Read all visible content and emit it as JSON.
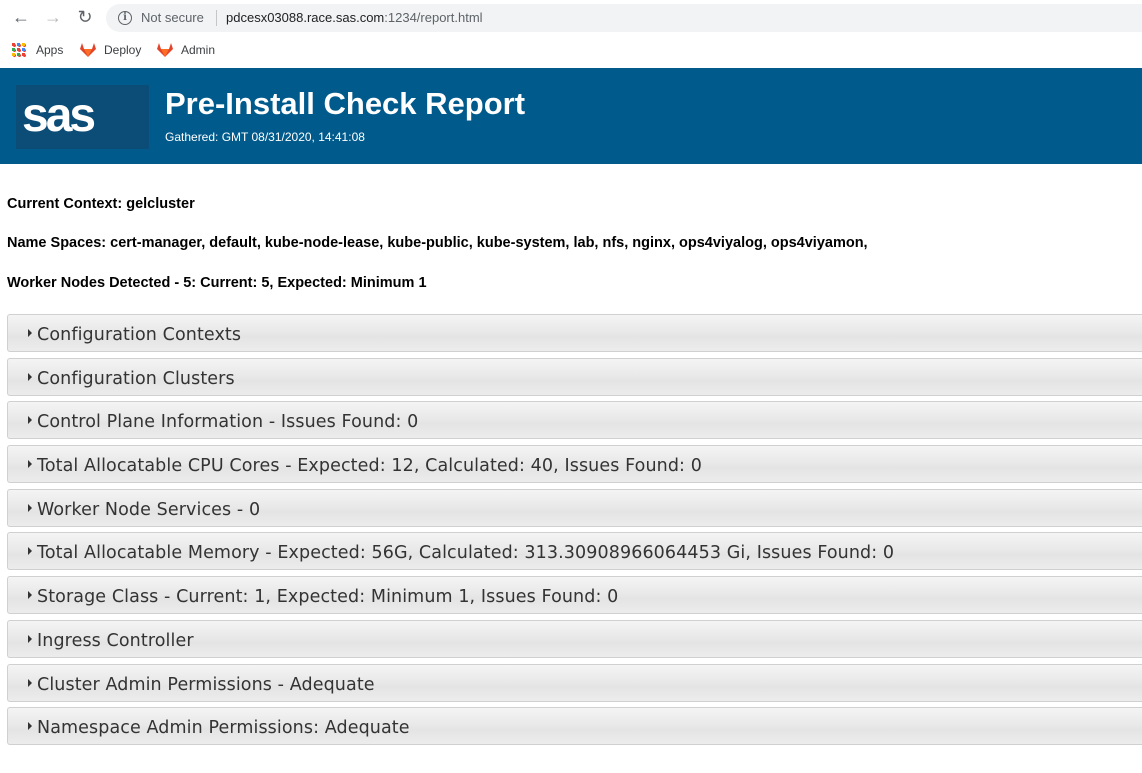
{
  "browser": {
    "security_label": "Not secure",
    "url_host": "pdcesx03088.race.sas.com",
    "url_rest": ":1234/report.html",
    "bookmarks": [
      {
        "label": "Apps",
        "icon": "apps-grid-icon"
      },
      {
        "label": "Deploy",
        "icon": "gitlab-fox-icon"
      },
      {
        "label": "Admin",
        "icon": "gitlab-fox-icon"
      }
    ]
  },
  "header": {
    "logo_text": "sas",
    "title": "Pre-Install Check Report",
    "gathered": "Gathered: GMT 08/31/2020, 14:41:08",
    "background_color": "#005a8c"
  },
  "info": {
    "current_context": "Current Context: gelcluster",
    "namespaces": "Name Spaces: cert-manager, default, kube-node-lease, kube-public, kube-system, lab, nfs, nginx, ops4viyalog, ops4viyamon,",
    "worker_nodes": "Worker Nodes Detected - 5: Current: 5, Expected: Minimum 1"
  },
  "sections": [
    {
      "label": "Configuration Contexts"
    },
    {
      "label": "Configuration Clusters"
    },
    {
      "label": "Control Plane Information - Issues Found: 0"
    },
    {
      "label": "Total Allocatable CPU Cores - Expected: 12, Calculated: 40, Issues Found: 0"
    },
    {
      "label": "Worker Node Services - 0"
    },
    {
      "label": "Total Allocatable Memory - Expected: 56G, Calculated: 313.30908966064453 Gi, Issues Found: 0"
    },
    {
      "label": "Storage Class - Current: 1, Expected: Minimum 1, Issues Found: 0"
    },
    {
      "label": "Ingress Controller"
    },
    {
      "label": "Cluster Admin Permissions - Adequate"
    },
    {
      "label": "Namespace Admin Permissions: Adequate"
    }
  ]
}
